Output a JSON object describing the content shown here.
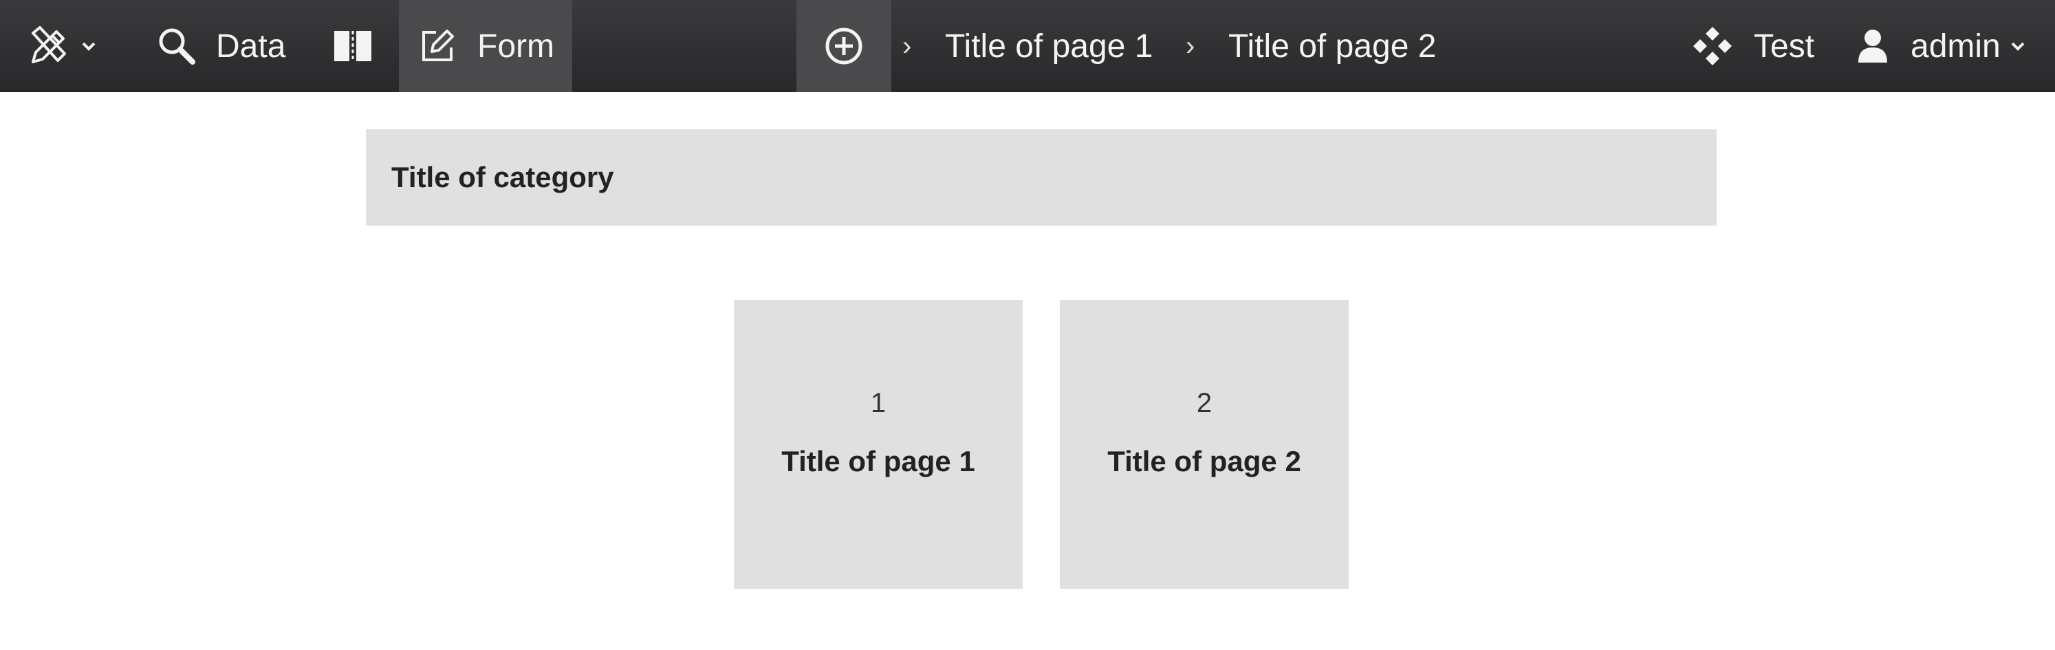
{
  "toolbar": {
    "data_label": "Data",
    "form_label": "Form",
    "test_label": "Test",
    "user_label": "admin"
  },
  "breadcrumb": {
    "separator": "›",
    "items": [
      {
        "label": "Title of page 1"
      },
      {
        "label": "Title of page 2"
      }
    ]
  },
  "category": {
    "title": "Title of category"
  },
  "pages": [
    {
      "number": "1",
      "title": "Title of page 1"
    },
    {
      "number": "2",
      "title": "Title of page 2"
    }
  ],
  "colors": {
    "topbar_bg": "#2e2e30",
    "topbar_active": "#4a4a4d",
    "panel_bg": "#e0e0e0",
    "text_dark": "#222222",
    "text_light": "#f4f4f4"
  },
  "icons": {
    "design": "pencil-ruler-icon",
    "design_menu": "chevron-down-icon",
    "data": "magnifier-icon",
    "layout": "split-columns-icon",
    "form": "edit-form-icon",
    "add": "plus-circle-icon",
    "test": "diamond-grid-icon",
    "user": "user-icon",
    "user_menu": "chevron-down-icon"
  }
}
